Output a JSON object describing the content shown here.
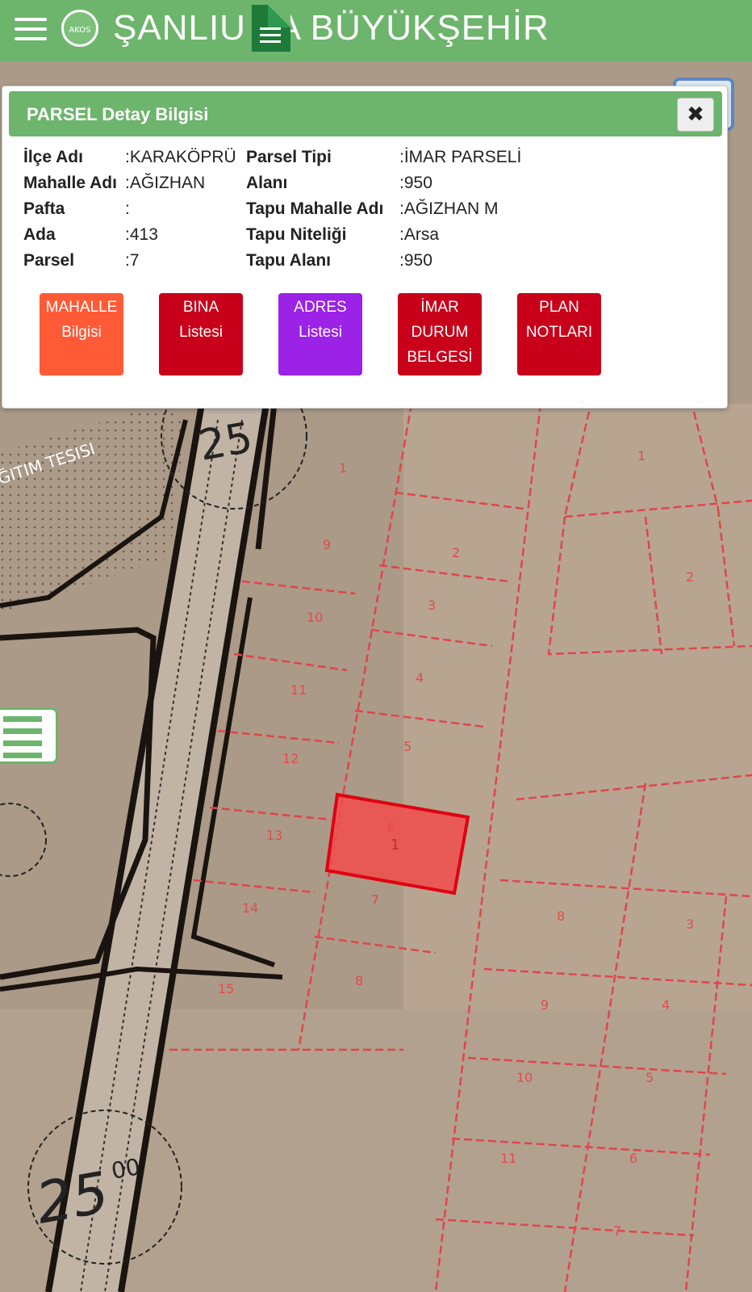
{
  "app": {
    "title": "ŞANLIU  FA BÜYÜKŞEHİR",
    "logo_text": "AKOS"
  },
  "colors": {
    "header_green": "#6db46c",
    "parcel_fill": "#f24c4c",
    "btn_mahalle": "#ff5a36",
    "btn_bina": "#c8001a",
    "btn_adres": "#9b22e6",
    "btn_imar": "#c8001a",
    "btn_plan": "#c8001a"
  },
  "panel": {
    "title": "PARSEL Detay Bilgisi",
    "close_icon": "close-icon",
    "left_fields": [
      {
        "label": "İlçe Adı",
        "value": ":KARAKÖPRÜ"
      },
      {
        "label": "Mahalle Adı",
        "value": ":AĞIZHAN"
      },
      {
        "label": "Pafta",
        "value": ":"
      },
      {
        "label": "Ada",
        "value": ":413"
      },
      {
        "label": "Parsel",
        "value": ":7"
      }
    ],
    "right_fields": [
      {
        "label": "Parsel Tipi",
        "value": ":İMAR PARSELİ"
      },
      {
        "label": "Alanı",
        "value": ":950"
      },
      {
        "label": "Tapu Mahalle Adı",
        "value": ":AĞIZHAN M"
      },
      {
        "label": "Tapu Niteliği",
        "value": ":Arsa"
      },
      {
        "label": "Tapu Alanı",
        "value": ":950"
      }
    ],
    "buttons": [
      {
        "line1": "MAHALLE",
        "line2": "Bilgisi",
        "line3": ""
      },
      {
        "line1": "BINA",
        "line2": "Listesi",
        "line3": ""
      },
      {
        "line1": "ADRES",
        "line2": "Listesi",
        "line3": ""
      },
      {
        "line1": "İMAR",
        "line2": "DURUM",
        "line3": "BELGESİ"
      },
      {
        "line1": "PLAN",
        "line2": "NOTLARI",
        "line3": ""
      }
    ]
  },
  "map": {
    "road_label_top": "25",
    "road_label_bottom": "25",
    "road_label_bottom_sup": "00",
    "facility_label": "ĞITIM TESISI",
    "selected_parcel_no": "1",
    "parcel_numbers": [
      "1",
      "2",
      "3",
      "4",
      "5",
      "6",
      "7",
      "8",
      "9",
      "10",
      "11",
      "12",
      "13",
      "14",
      "15",
      "1",
      "2",
      "3",
      "4",
      "5",
      "6",
      "7",
      "8",
      "9",
      "10",
      "11"
    ]
  },
  "side_menu": {
    "icon": "menu-icon"
  }
}
